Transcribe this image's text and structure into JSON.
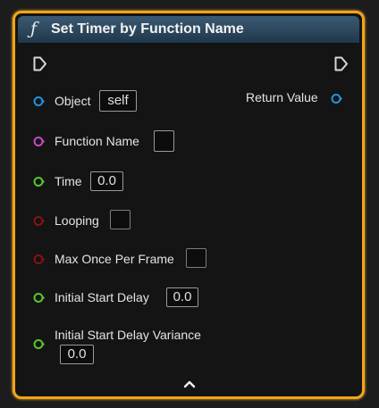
{
  "node": {
    "title": "Set Timer by Function Name",
    "icon": "function-icon",
    "colors": {
      "border": "#f2a516",
      "header": "#2c4a63",
      "exec": "#d8d8d8",
      "object_pin": "#1e94e0",
      "name_pin": "#c44bc4",
      "float_pin": "#56c82a",
      "bool_pin": "#8b1111"
    },
    "pins": {
      "exec_in": "exec-in-pin",
      "exec_out": "exec-out-pin",
      "object": {
        "label": "Object",
        "value": "self"
      },
      "function_name": {
        "label": "Function Name",
        "value": ""
      },
      "time": {
        "label": "Time",
        "value": "0.0"
      },
      "looping": {
        "label": "Looping",
        "checked": false
      },
      "max_once": {
        "label": "Max Once Per Frame",
        "checked": false
      },
      "initial_start_delay": {
        "label": "Initial Start Delay",
        "value": "0.0"
      },
      "initial_start_delay_variance": {
        "label": "Initial Start Delay Variance",
        "value": "0.0"
      },
      "return_value": {
        "label": "Return Value"
      }
    },
    "collapse": "chevron-up-icon"
  }
}
